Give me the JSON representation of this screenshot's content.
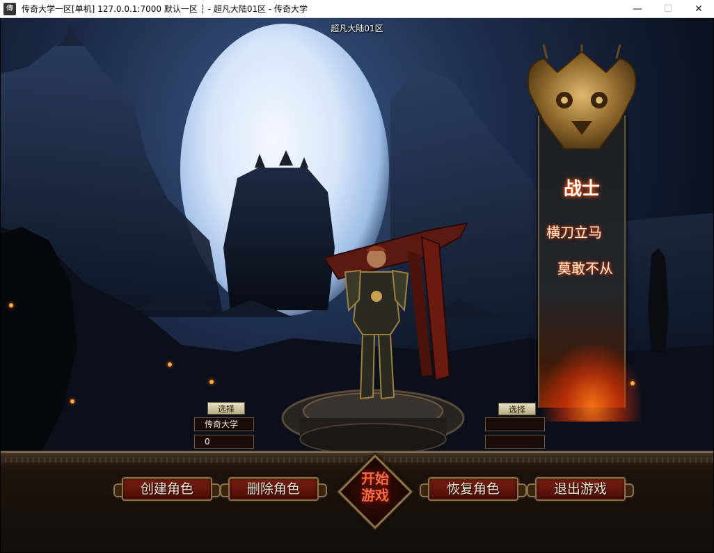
{
  "window": {
    "icon": "app-game-icon",
    "title": "传奇大学一区[单机] 127.0.0.1:7000  默认一区 ┆ - 超凡大陆01区 - 传奇大学",
    "controls": {
      "minimize": "—",
      "maximize": "☐",
      "close": "✕"
    }
  },
  "server_label": "超凡大陆01区",
  "class_banner": {
    "class_name": "战士",
    "motto_line1": "横刀立马",
    "motto_line2": "莫敢不从"
  },
  "slots": {
    "left": {
      "select_label": "选择",
      "name": "传奇大学",
      "level": "0"
    },
    "right": {
      "select_label": "选择",
      "name": "",
      "level": ""
    }
  },
  "menu": {
    "create": "创建角色",
    "delete": "删除角色",
    "start_line1": "开始",
    "start_line2": "游戏",
    "restore": "恢复角色",
    "exit": "退出游戏"
  },
  "colors": {
    "button_red": "#7a1f14",
    "gold_border": "#8c7448",
    "start_text": "#ff6a3a"
  }
}
